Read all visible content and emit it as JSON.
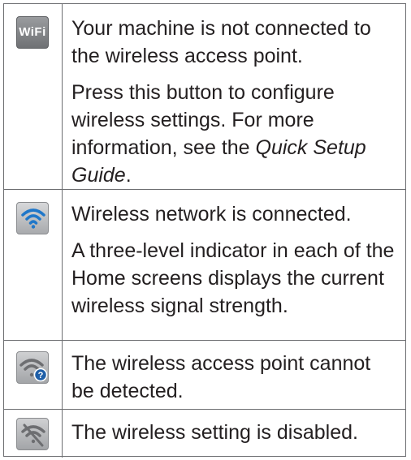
{
  "rows": [
    {
      "icon": "wifi-setup-icon",
      "icon_label": "WiFi",
      "paragraphs": [
        "Your machine is not connected to the wireless access point.",
        "Press this button to configure wireless settings. For more information, see the"
      ],
      "link_italic_1": "Quick Setup Guide",
      "trailing": "."
    },
    {
      "icon": "wifi-connected-icon",
      "paragraphs": [
        "Wireless network is connected.",
        "A three-level indicator in each of the Home screens displays the current wireless signal strength."
      ]
    },
    {
      "icon": "wifi-not-detected-icon",
      "paragraphs": [
        "The wireless access point cannot be detected."
      ]
    },
    {
      "icon": "wifi-disabled-icon",
      "paragraphs": [
        "The wireless setting is disabled."
      ]
    }
  ],
  "colors": {
    "connected_blue": "#1f77c9",
    "gray_icon": "#6d6e71",
    "badge_blue": "#1f5fa8",
    "border": "#6d6e71"
  }
}
